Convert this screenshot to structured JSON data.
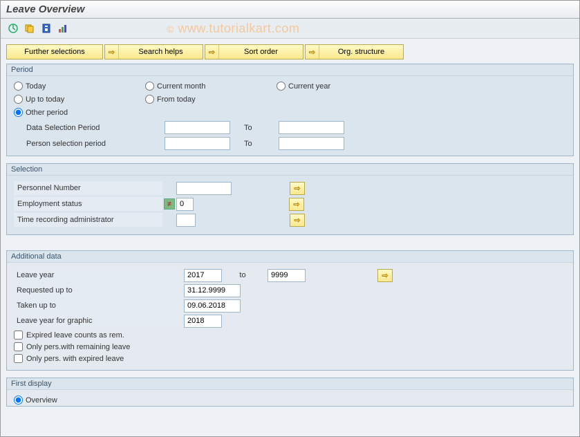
{
  "title": "Leave Overview",
  "watermark": "© www.tutorialkart.com",
  "top_buttons": {
    "further": "Further selections",
    "search": "Search helps",
    "sort": "Sort order",
    "org": "Org. structure"
  },
  "period": {
    "title": "Period",
    "today": "Today",
    "current_month": "Current month",
    "current_year": "Current year",
    "up_to_today": "Up to today",
    "from_today": "From today",
    "other_period": "Other period",
    "data_sel": "Data Selection Period",
    "person_sel": "Person selection period",
    "to": "To",
    "data_sel_from": "",
    "data_sel_to": "",
    "person_sel_from": "",
    "person_sel_to": ""
  },
  "selection": {
    "title": "Selection",
    "pernr": "Personnel Number",
    "emp_status": "Employment status",
    "time_admin": "Time recording administrator",
    "pernr_val": "",
    "emp_status_val": "0",
    "time_admin_val": ""
  },
  "additional": {
    "title": "Additional data",
    "leave_year": "Leave year",
    "to": "to",
    "leave_year_from": "2017",
    "leave_year_to": "9999",
    "requested": "Requested up to",
    "requested_val": "31.12.9999",
    "taken": "Taken up to",
    "taken_val": "09.06.2018",
    "graphic_year": "Leave year for graphic",
    "graphic_year_val": "2018",
    "chk_expired_rem": "Expired leave counts as rem.",
    "chk_remaining": "Only pers.with remaining leave",
    "chk_expired": "Only pers. with expired leave"
  },
  "first_display": {
    "title": "First display",
    "overview": "Overview"
  }
}
